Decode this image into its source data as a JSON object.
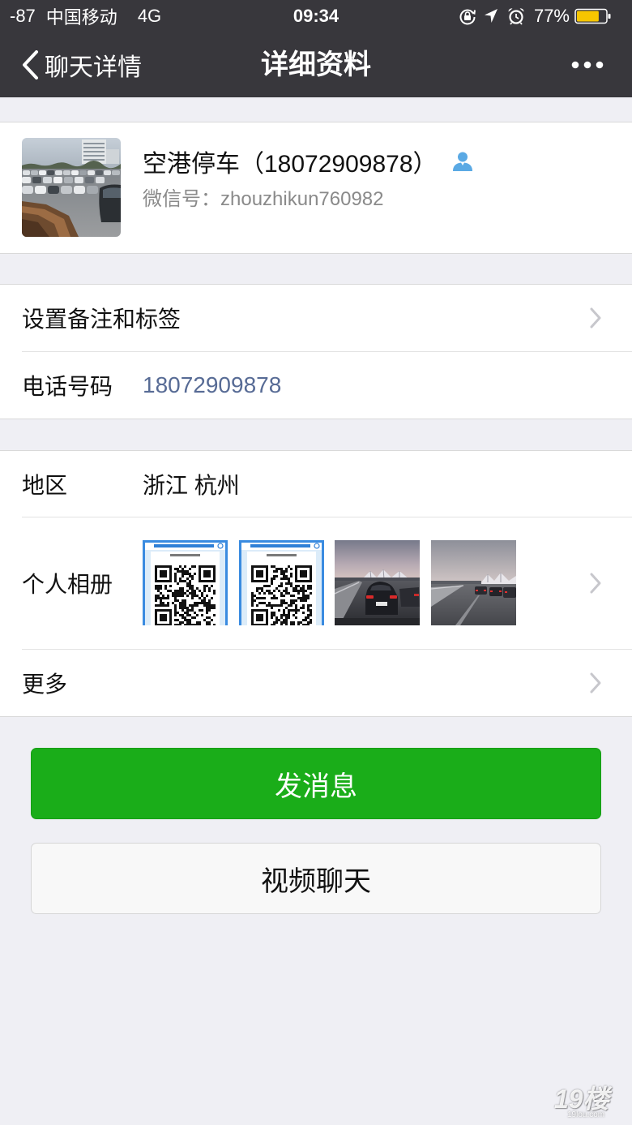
{
  "status_bar": {
    "signal_strength": "-87",
    "carrier": "中国移动",
    "network": "4G",
    "time": "09:34",
    "battery_percent": "77%",
    "battery_level": 0.77,
    "icons": [
      "orientation-lock-icon",
      "location-arrow-icon",
      "alarm-clock-icon",
      "battery-icon"
    ]
  },
  "nav": {
    "back_icon": "chevron-left-icon",
    "back_label": "聊天详情",
    "title": "详细资料",
    "more_icon": "more-icon"
  },
  "profile": {
    "name": "空港停车（18072909878）",
    "contact_icon": "person-icon",
    "wechat_id_label": "微信号：",
    "wechat_id": "zhouzhikun760982"
  },
  "info_section": {
    "remark_label": "设置备注和标签",
    "phone_label": "电话号码",
    "phone_number": "18072909878"
  },
  "detail_section": {
    "region_label": "地区",
    "region_value": "浙江 杭州",
    "album_label": "个人相册",
    "more_label": "更多",
    "chevron_icon": "chevron-right-icon"
  },
  "actions": {
    "send_message": "发消息",
    "video_chat": "视频聊天"
  },
  "watermark": {
    "logo_text": "19楼",
    "site_text": "19lou.com"
  },
  "colors": {
    "nav_background": "#38373c",
    "page_background": "#efeff4",
    "primary_green": "#1aad19",
    "link_blue": "#576b95",
    "battery_fill": "#f7c600",
    "contact_icon_blue": "#5aa9e4"
  }
}
